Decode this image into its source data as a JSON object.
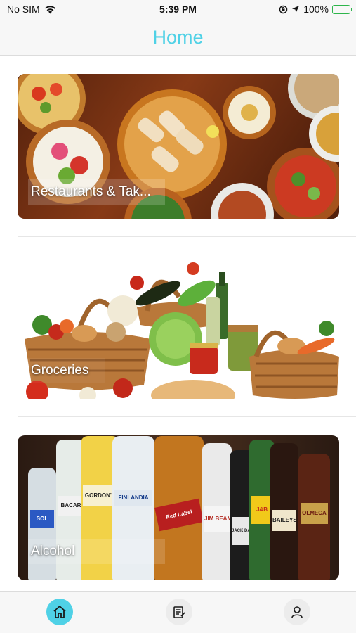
{
  "status_bar": {
    "carrier": "No SIM",
    "time": "5:39 PM",
    "battery": "100%"
  },
  "header": {
    "title": "Home"
  },
  "categories": [
    {
      "label": "Restaurants & Tak..."
    },
    {
      "label": "Groceries"
    },
    {
      "label": "Alcohol"
    }
  ],
  "bottles": [
    "SOL",
    "BACARDI",
    "GORDON'S",
    "FINLANDIA",
    "Red Label",
    "JIM BEAM",
    "JACK DANIEL'S",
    "J&B",
    "BAILEYS",
    "OLMECA"
  ],
  "tab_bar": {
    "items": [
      {
        "icon": "home-icon",
        "active": true
      },
      {
        "icon": "orders-icon",
        "active": false
      },
      {
        "icon": "profile-icon",
        "active": false
      }
    ]
  },
  "colors": {
    "accent": "#4fd1e6",
    "background": "#ffffff",
    "bar": "#f7f7f7"
  }
}
